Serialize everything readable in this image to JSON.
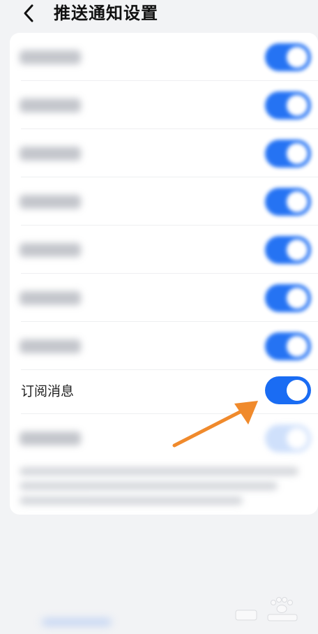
{
  "header": {
    "title": "推送通知设置"
  },
  "settings": {
    "visible_item": {
      "label": "订阅消息",
      "enabled": true
    },
    "blurred_item_count": 8
  },
  "colors": {
    "toggle_on": "#1a6cf3",
    "arrow": "#f08a2c",
    "background": "#f2f3f5",
    "card": "#ffffff"
  },
  "icons": {
    "back": "chevron-left-icon",
    "annotation": "arrow-icon"
  }
}
